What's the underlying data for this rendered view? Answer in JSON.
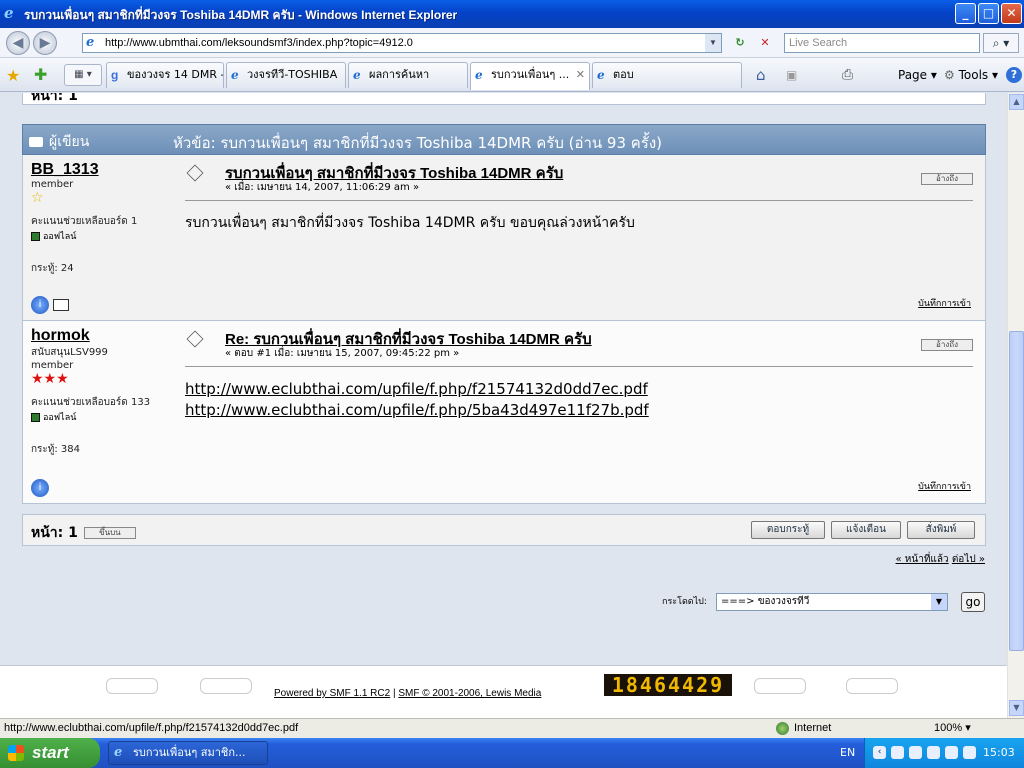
{
  "window": {
    "title": "รบกวนเพื่อนๆ สมาชิกที่มีวงจร Toshiba 14DMR ครับ - Windows Internet Explorer",
    "min": "_",
    "max": "□",
    "close": "✕"
  },
  "addressbar": {
    "url": "http://www.ubmthai.com/leksoundsmf3/index.php?topic=4912.0",
    "search_placeholder": "Live Search",
    "back": "◀",
    "forward": "▶",
    "refresh": "↻",
    "stop": "✕",
    "search_icon": "⌕"
  },
  "tabs": [
    {
      "label": "ของวงจร 14 DMR -...",
      "icon": "google-icon",
      "active": false
    },
    {
      "label": "วงจรทีวี-TOSHIBA",
      "icon": "ie-icon",
      "active": false
    },
    {
      "label": "ผลการค้นหา",
      "icon": "ie-icon",
      "active": false
    },
    {
      "label": "รบกวนเพื่อนๆ ...",
      "icon": "ie-icon",
      "active": true
    },
    {
      "label": "ตอบ",
      "icon": "ie-icon",
      "active": false
    }
  ],
  "commandbar": {
    "home": "⌂",
    "feeds": "▣",
    "print": "⎙",
    "page": "Page",
    "tools": "Tools",
    "help": "?",
    "star": "★",
    "add": "✚",
    "quick": "▦ ▾"
  },
  "forum": {
    "page_label": "หน้า: 1",
    "author_header": "ผู้เขียน",
    "topic_header": "หัวข้อ: รบกวนเพื่อนๆ สมาชิกที่มีวงจร Toshiba 14DMR ครับ  (อ่าน 93 ครั้ง)",
    "posts": [
      {
        "username": "BB_1313",
        "rank": "member",
        "stars": "☆",
        "help_points": "คะแนนช่วยเหลือบอร์ด 1",
        "status": "ออฟไลน์",
        "post_count": "กระทู้: 24",
        "subject": "รบกวนเพื่อนๆ สมาชิกที่มีวงจร Toshiba 14DMR ครับ",
        "meta": "« เมื่อ: เมษายน 14, 2007, 11:06:29 am »",
        "message": "รบกวนเพื่อนๆ สมาชิกที่มีวงจร Toshiba 14DMR ครับ ขอบคุณล่วงหน้าครับ",
        "report": "บันทึกการเข้า",
        "quote_btn": "อ้างถึง"
      },
      {
        "username": "hormok",
        "title_line": "สนับสนุนLSV999",
        "rank": "member",
        "stars": "★★★",
        "help_points": "คะแนนช่วยเหลือบอร์ด 133",
        "status": "ออฟไลน์",
        "post_count": "กระทู้: 384",
        "subject": "Re: รบกวนเพื่อนๆ สมาชิกที่มีวงจร Toshiba 14DMR ครับ",
        "meta": "« ตอบ #1 เมื่อ: เมษายน 15, 2007, 09:45:22 pm »",
        "links": [
          "http://www.eclubthai.com/upfile/f.php/f21574132d0dd7ec.pdf",
          "http://www.eclubthai.com/upfile/f.php/5ba43d497e11f27b.pdf"
        ],
        "report": "บันทึกการเข้า",
        "quote_btn": "อ้างถึง"
      }
    ],
    "bottom_page_label": "หน้า: 1",
    "page_mini": "ขึ้นบน",
    "buttons": {
      "reply": "ตอบกระทู้",
      "notify": "แจ้งเตือน",
      "print": "สั่งพิมพ์"
    },
    "prev": "« หน้าที่แล้ว",
    "next": "ต่อไป »",
    "jump_label": "กระโดดไป:",
    "jump_value": "===> ของวงจรทีวี",
    "go": "go",
    "powered": "Powered by SMF 1.1 RC2",
    "copyright": "SMF © 2001-2006, Lewis Media",
    "counter": "18464429"
  },
  "status": {
    "url": "http://www.eclubthai.com/upfile/f.php/f21574132d0dd7ec.pdf",
    "zone": "Internet",
    "zoom": "100% ▾"
  },
  "taskbar": {
    "start": "start",
    "item": "รบกวนเพื่อนๆ สมาชิก...",
    "lang": "EN",
    "clock": "15:03"
  }
}
